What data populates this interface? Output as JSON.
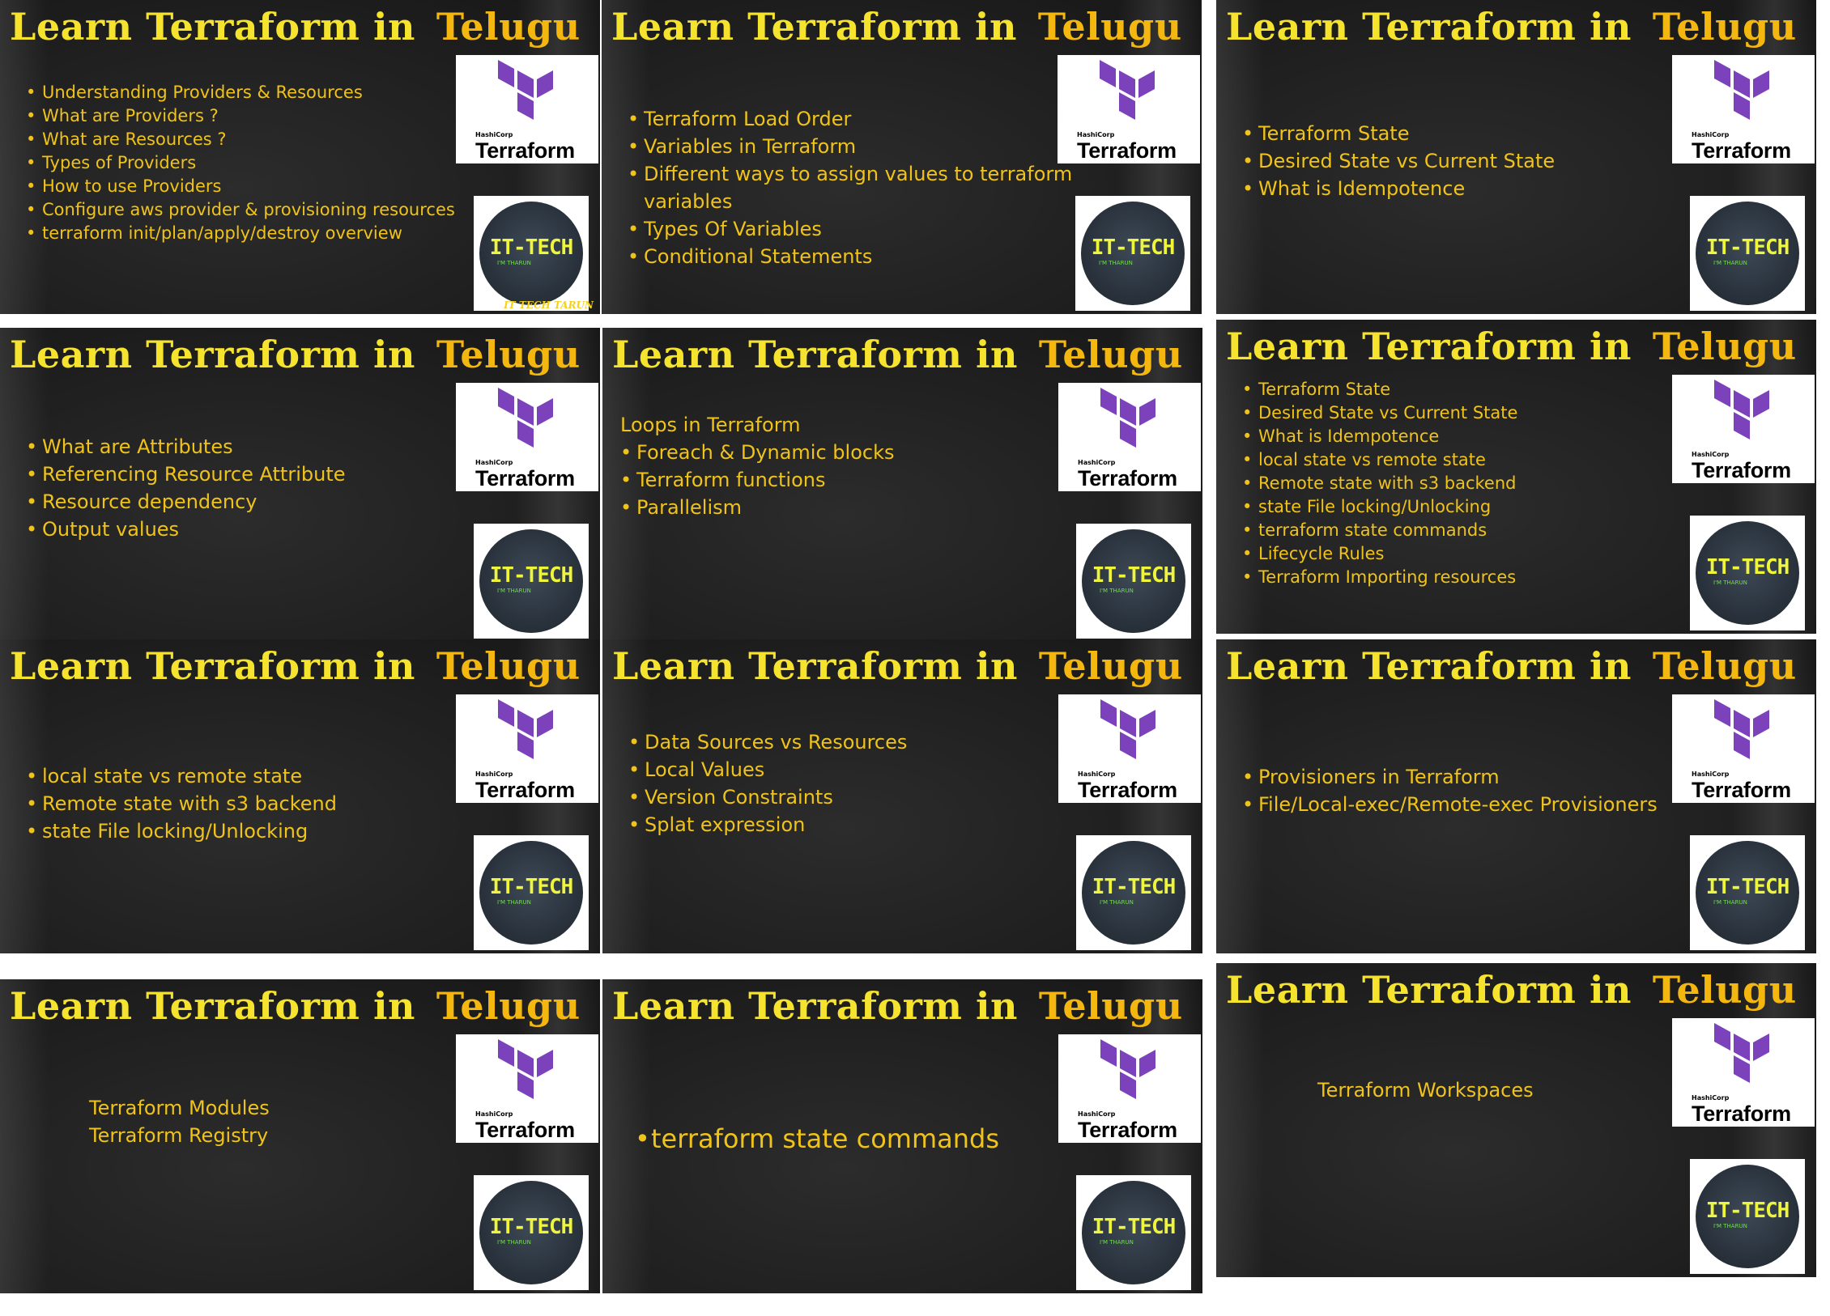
{
  "slides": [
    {
      "title": "Learn Terraform in",
      "title_accent": "Telugu",
      "bullets": [
        "Understanding Providers & Resources",
        "What are Providers ?",
        "What are Resources ?",
        "Types of Providers",
        "How to use Providers",
        "Configure  aws provider & provisioning resources",
        "terraform init/plan/apply/destroy overview"
      ],
      "footer": "IT TECH TARUN"
    },
    {
      "title": "Learn Terraform in",
      "title_accent": "Telugu",
      "bullets": [
        "Terraform Load Order",
        "Variables in Terraform",
        "Different ways to assign values to terraform variables",
        "Types Of Variables",
        "Conditional Statements"
      ]
    },
    {
      "title": "Learn Terraform in",
      "title_accent": "Telugu",
      "bullets": [
        "Terraform State",
        "Desired State vs Current State",
        "What is Idempotence"
      ]
    },
    {
      "title": "Learn Terraform in",
      "title_accent": "Telugu",
      "bullets": [
        "What are Attributes",
        "Referencing Resource Attribute",
        "Resource dependency",
        "Output values"
      ]
    },
    {
      "title": "Learn Terraform in",
      "title_accent": "Telugu",
      "intro": "Loops in Terraform",
      "bullets": [
        "Foreach & Dynamic blocks",
        "Terraform functions",
        "Parallelism"
      ]
    },
    {
      "title": "Learn Terraform in",
      "title_accent": "Telugu",
      "bullets": [
        "Terraform State",
        "Desired State vs Current State",
        "What is Idempotence",
        "local state vs remote state",
        "Remote state with s3 backend",
        "state File locking/Unlocking",
        "terraform state commands",
        "Lifecycle Rules",
        "Terraform Importing resources"
      ]
    },
    {
      "title": "Learn Terraform in",
      "title_accent": "Telugu",
      "bullets": [
        "local state vs remote state",
        "Remote state with s3 backend",
        "state File locking/Unlocking"
      ]
    },
    {
      "title": "Learn Terraform in",
      "title_accent": "Telugu",
      "bullets": [
        "Data Sources vs Resources",
        "Local Values",
        "Version Constraints",
        "Splat expression"
      ]
    },
    {
      "title": "Learn Terraform in",
      "title_accent": "Telugu",
      "bullets": [
        "Provisioners in Terraform",
        "File/Local-exec/Remote-exec Provisioners"
      ]
    },
    {
      "title": "Learn Terraform in",
      "title_accent": "Telugu",
      "bullets": [
        "Terraform Modules",
        "Terraform Registry"
      ]
    },
    {
      "title": "Learn Terraform in",
      "title_accent": "Telugu",
      "bullets": [
        "terraform state commands"
      ]
    },
    {
      "title": "Learn Terraform in",
      "title_accent": "Telugu",
      "bullets": [
        "Terraform Workspaces"
      ]
    }
  ],
  "logos": {
    "terraform_brand": "HashiCorp",
    "terraform_word": "Terraform",
    "ittech_word": "IT-TECH",
    "ittech_sub": "I'M THARUN"
  },
  "colors": {
    "title": "#f5e32d",
    "accent": "#f3b70f",
    "bullet": "#f0c31a",
    "terraform_purple": "#7b42bc"
  }
}
